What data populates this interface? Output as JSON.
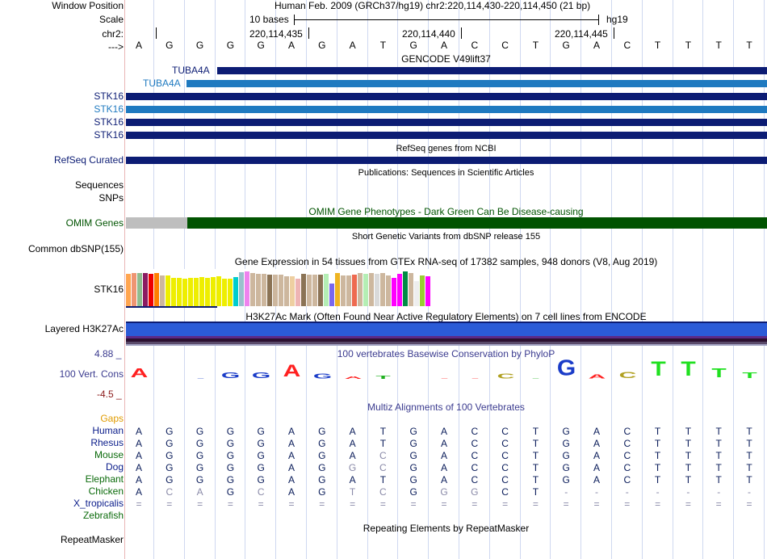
{
  "colors": {
    "gencode_dark": "#0c1c74",
    "gencode_light": "#1f7ac0",
    "refseq": "#0c1c74",
    "omim_green": "#005300",
    "omim_gray": "#bebebe",
    "h3k27_blue": "#2b5bd7",
    "phylop_label": "#3b3b8f",
    "species_green": "#0a6a0a",
    "species_blue": "#0a1c8a",
    "gaps_orange": "#e09b00"
  },
  "header": {
    "window_position_label": "Window Position",
    "window_position_value": "Human Feb. 2009 (GRCh37/hg19)   chr2:220,114,430-220,114,450 (21 bp)",
    "scale_label": "Scale",
    "scale_value": "10 bases",
    "scale_assembly": "hg19",
    "chrom_label": "chr2:",
    "coord_ticks": [
      "220,114,435",
      "220,114,440",
      "220,114,445"
    ],
    "strand_label": "--->",
    "bases": [
      "A",
      "G",
      "G",
      "G",
      "G",
      "A",
      "G",
      "A",
      "T",
      "G",
      "A",
      "C",
      "C",
      "T",
      "G",
      "A",
      "C",
      "T",
      "T",
      "T",
      "T"
    ]
  },
  "tracks": {
    "gencode_title": "GENCODE V49lift37",
    "gencode_genes": [
      "TUBA4A",
      "TUBA4A",
      "STK16",
      "STK16",
      "STK16",
      "STK16"
    ],
    "refseq_title": "RefSeq genes from NCBI",
    "refseq_label": "RefSeq Curated",
    "pubs_title": "Publications: Sequences in Scientific Articles",
    "sequences_label": "Sequences",
    "snps_label": "SNPs",
    "omim_title": "OMIM Gene Phenotypes - Dark Green Can Be Disease-causing",
    "omim_label": "OMIM Genes",
    "dbsnp_title": "Short Genetic Variants from dbSNP release 155",
    "dbsnp_label": "Common dbSNP(155)",
    "gtex_title": "Gene Expression in 54 tissues from GTEx RNA-seq of 17382 samples, 948 donors (V8, Aug 2019)",
    "gtex_label": "STK16",
    "h3k27_title": "H3K27Ac Mark (Often Found Near Active Regulatory Elements) on 7 cell lines from ENCODE",
    "h3k27_label": "Layered H3K27Ac",
    "phylop_title": "100 vertebrates Basewise Conservation by PhyloP",
    "phylop_label": "100 Vert. Cons",
    "phylop_max": "4.88 _",
    "phylop_min": "-4.5 _",
    "multiz_title": "Multiz Alignments of 100 Vertebrates",
    "gaps_label": "Gaps",
    "repeat_title": "Repeating Elements by RepeatMasker",
    "repeat_label": "RepeatMasker"
  },
  "species": [
    {
      "name": "Human",
      "color": "#0a1c8a",
      "bases": [
        "A",
        "G",
        "G",
        "G",
        "G",
        "A",
        "G",
        "A",
        "T",
        "G",
        "A",
        "C",
        "C",
        "T",
        "G",
        "A",
        "C",
        "T",
        "T",
        "T",
        "T"
      ]
    },
    {
      "name": "Rhesus",
      "color": "#0a1c8a",
      "bases": [
        "A",
        "G",
        "G",
        "G",
        "G",
        "A",
        "G",
        "A",
        "T",
        "G",
        "A",
        "C",
        "C",
        "T",
        "G",
        "A",
        "C",
        "T",
        "T",
        "T",
        "T"
      ]
    },
    {
      "name": "Mouse",
      "color": "#0a6a0a",
      "bases": [
        "A",
        "G",
        "G",
        "G",
        "G",
        "A",
        "G",
        "A",
        "C",
        "G",
        "A",
        "C",
        "C",
        "T",
        "G",
        "A",
        "C",
        "T",
        "T",
        "T",
        "T"
      ]
    },
    {
      "name": "Dog",
      "color": "#0a1c8a",
      "bases": [
        "A",
        "G",
        "G",
        "G",
        "G",
        "A",
        "G",
        "G",
        "C",
        "G",
        "A",
        "C",
        "C",
        "T",
        "G",
        "A",
        "C",
        "T",
        "T",
        "T",
        "T"
      ]
    },
    {
      "name": "Elephant",
      "color": "#0a6a0a",
      "bases": [
        "A",
        "G",
        "G",
        "G",
        "G",
        "A",
        "G",
        "A",
        "T",
        "G",
        "A",
        "C",
        "C",
        "T",
        "G",
        "A",
        "C",
        "T",
        "T",
        "T",
        "T"
      ]
    },
    {
      "name": "Chicken",
      "color": "#0a6a0a",
      "bases": [
        "A",
        "C",
        "A",
        "G",
        "C",
        "A",
        "G",
        "T",
        "C",
        "G",
        "G",
        "G",
        "C",
        "T",
        "-",
        "-",
        "-",
        "-",
        "-",
        "-",
        "-"
      ]
    },
    {
      "name": "X_tropicalis",
      "color": "#0a1c8a",
      "bases": [
        "=",
        "=",
        "=",
        "=",
        "=",
        "=",
        "=",
        "=",
        "=",
        "=",
        "=",
        "=",
        "=",
        "=",
        "=",
        "=",
        "=",
        "=",
        "=",
        "=",
        "="
      ]
    },
    {
      "name": "Zebrafish",
      "color": "#0a6a0a",
      "bases": [
        "",
        "",
        "",
        "",
        "",
        "",
        "",
        "",
        "",
        "",
        "",
        "",
        "",
        "",
        "",
        "",
        "",
        "",
        "",
        "",
        ""
      ]
    }
  ],
  "gtex_values": [
    0.92,
    0.95,
    0.96,
    0.95,
    0.92,
    0.95,
    0.88,
    0.88,
    0.82,
    0.82,
    0.8,
    0.82,
    0.82,
    0.84,
    0.82,
    0.84,
    0.86,
    0.8,
    0.78,
    0.84,
    0.98,
    1.0,
    0.96,
    0.92,
    0.92,
    0.9,
    0.9,
    0.9,
    0.85,
    0.85,
    0.8,
    0.92,
    0.9,
    0.9,
    0.9,
    0.92,
    0.65,
    0.95,
    0.88,
    0.88,
    0.9,
    0.95,
    0.92,
    0.95,
    0.92,
    0.95,
    0.88,
    0.82,
    0.92,
    1.0,
    0.95,
    0.72,
    0.88,
    0.85
  ],
  "gtex_colors": [
    "#ffa54f",
    "#ee9572",
    "#8fbc8f",
    "#8b1c62",
    "#ee0000",
    "#ff7f00",
    "#cdb79e",
    "#eeee00",
    "#eeee00",
    "#eeee00",
    "#eeee00",
    "#eeee00",
    "#eeee00",
    "#eeee00",
    "#eeee00",
    "#eeee00",
    "#eeee00",
    "#eeee00",
    "#eeee00",
    "#00cdcd",
    "#9ac0cd",
    "#ee82ee",
    "#cdb79e",
    "#cdb79e",
    "#cdb79e",
    "#8b7355",
    "#cdb79e",
    "#cdb79e",
    "#cdb79e",
    "#eecfa1",
    "#eeb4b4",
    "#8b7355",
    "#cdb79e",
    "#cdb79e",
    "#8b7355",
    "#b4eeb4",
    "#7a67ee",
    "#eeb422",
    "#cdb79e",
    "#cdb79e",
    "#ee6a50",
    "#cdb79e",
    "#b4eeb4",
    "#cdb79e",
    "#d9d9d9",
    "#cdb79e",
    "#cdb79e",
    "#ff00ff",
    "#ff00ff",
    "#008b45",
    "#cdb79e",
    "#eeeeee",
    "#9acd32",
    "#ff00ff"
  ],
  "phylop": [
    {
      "b": "A",
      "c": "#ff2020",
      "h": 0.55
    },
    {
      "b": "",
      "c": "#000",
      "h": 0
    },
    {
      "b": "-",
      "c": "#1a3cc8",
      "h": 0.05
    },
    {
      "b": "G",
      "c": "#1a3cc8",
      "h": 0.35
    },
    {
      "b": "G",
      "c": "#1a3cc8",
      "h": 0.35
    },
    {
      "b": "A",
      "c": "#ff2020",
      "h": 0.75
    },
    {
      "b": "G",
      "c": "#1a3cc8",
      "h": 0.3
    },
    {
      "b": "A",
      "c": "#ff2020",
      "h": 0.15
    },
    {
      "b": "T",
      "c": "#20b020",
      "h": 0.2
    },
    {
      "b": "",
      "c": "#000",
      "h": 0
    },
    {
      "b": "-",
      "c": "#ff2020",
      "h": 0.05
    },
    {
      "b": "-",
      "c": "#ff2020",
      "h": 0.05
    },
    {
      "b": "C",
      "c": "#b0a020",
      "h": 0.3
    },
    {
      "b": "-",
      "c": "#20b020",
      "h": 0.05
    },
    {
      "b": "G",
      "c": "#1a3cc8",
      "h": 1.0
    },
    {
      "b": "A",
      "c": "#ff2020",
      "h": 0.25
    },
    {
      "b": "C",
      "c": "#b0a020",
      "h": 0.4
    },
    {
      "b": "T",
      "c": "#20e020",
      "h": 0.9
    },
    {
      "b": "T",
      "c": "#20e020",
      "h": 0.9
    },
    {
      "b": "T",
      "c": "#20e020",
      "h": 0.55
    },
    {
      "b": "T",
      "c": "#20e020",
      "h": 0.35
    }
  ]
}
